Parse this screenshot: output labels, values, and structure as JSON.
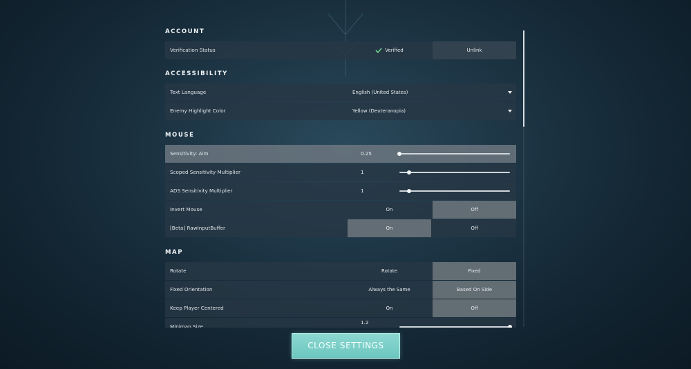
{
  "sections": {
    "account": "ACCOUNT",
    "accessibility": "ACCESSIBILITY",
    "mouse": "MOUSE",
    "map": "MAP"
  },
  "account": {
    "verification_label": "Verification Status",
    "verified_text": "Verified",
    "unlink_label": "Unlink"
  },
  "accessibility": {
    "text_language_label": "Text Language",
    "text_language_value": "English (United States)",
    "enemy_color_label": "Enemy Highlight Color",
    "enemy_color_value": "Yellow (Deuteranopia)"
  },
  "mouse": {
    "sens_aim_label": "Sensitivity: Aim",
    "sens_aim_value": "0.25",
    "sens_aim_fraction": 0.0,
    "scoped_label": "Scoped Sensitivity Multiplier",
    "scoped_value": "1",
    "scoped_fraction": 0.09,
    "ads_label": "ADS Sensitivity Multiplier",
    "ads_value": "1",
    "ads_fraction": 0.09,
    "invert_label": "Invert Mouse",
    "invert_on": "On",
    "invert_off": "Off",
    "invert_selected": "Off",
    "raw_label": "[Beta] RawInputBuffer",
    "raw_on": "On",
    "raw_off": "Off",
    "raw_selected": "On"
  },
  "map": {
    "rotate_label": "Rotate",
    "rotate_opt_a": "Rotate",
    "rotate_opt_b": "Fixed",
    "rotate_selected": "Fixed",
    "orientation_label": "Fixed Orientation",
    "orientation_opt_a": "Always the Same",
    "orientation_opt_b": "Based On Side",
    "orientation_selected": "Based On Side",
    "centered_label": "Keep Player Centered",
    "centered_on": "On",
    "centered_off": "Off",
    "centered_selected": "Off",
    "minimap_label": "Minimap Size",
    "minimap_value": "1.2",
    "minimap_fraction": 1.0
  },
  "close_button": "CLOSE SETTINGS",
  "colors": {
    "accent": "#6cc7bf",
    "row_bg": "#273744",
    "selected_bg": "#69737a"
  },
  "icons": {
    "verified": "check-icon",
    "dropdown": "caret-down-icon"
  }
}
